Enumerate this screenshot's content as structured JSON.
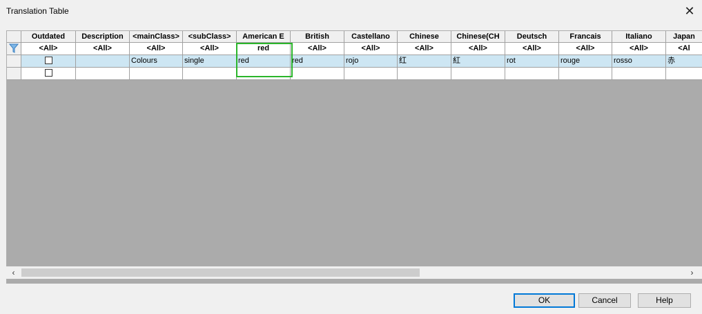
{
  "window": {
    "title": "Translation Table",
    "close_glyph": "✕"
  },
  "columns": [
    "Outdated",
    "Description",
    "<mainClass>",
    "<subClass>",
    "American E",
    "British",
    "Castellano",
    "Chinese",
    "Chinese(CH",
    "Deutsch",
    "Francais",
    "Italiano",
    "Japan"
  ],
  "filter_row": [
    "<All>",
    "<All>",
    "<All>",
    "<All>",
    "red",
    "<All>",
    "<All>",
    "<All>",
    "<All>",
    "<All>",
    "<All>",
    "<All>",
    "<Al"
  ],
  "data_row": [
    "",
    "",
    "Colours",
    "single",
    "red",
    "red",
    "rojo",
    "红",
    "紅",
    "rot",
    "rouge",
    "rosso",
    "赤"
  ],
  "scroll": {
    "left": "‹",
    "right": "›"
  },
  "buttons": {
    "ok": "OK",
    "cancel": "Cancel",
    "help": "Help"
  },
  "colors": {
    "selected_row": "#cde6f3",
    "editor_border": "#2bb52b",
    "default_button": "#0078d7"
  },
  "icons": {
    "filter": "filter-icon",
    "close": "close-icon"
  }
}
